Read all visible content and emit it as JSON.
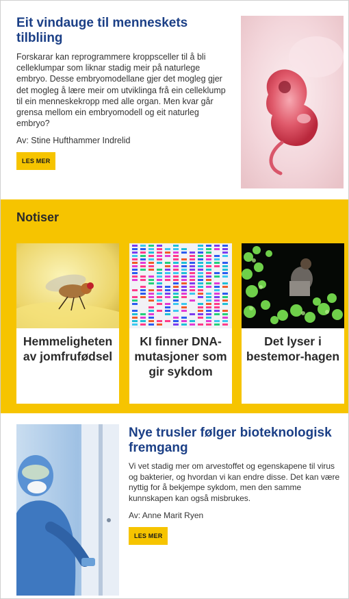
{
  "article1": {
    "title": "Eit vindauge til menneskets tilbliing",
    "summary": "Forskarar kan reprogrammere kroppsceller til å bli celleklumpar som liknar stadig meir på naturlege embryo. Desse embryomodellane gjer det mogleg gjer det mogleg å lære meir om utviklinga frå ein celleklump til ein menneskekropp med alle organ. Men kvar går grensa mellom ein embryomodell og eit naturleg embryo?",
    "byline": "Av: Stine Hufthammer Indrelid",
    "button": "LES MER",
    "image_icon": "embryo-photo"
  },
  "notiser": {
    "heading": "Notiser",
    "cards": [
      {
        "caption": "Hemmeligheten av jomfrufødsel",
        "image_icon": "fruit-fly-photo"
      },
      {
        "caption": "KI finner DNA-mutasjoner som gir sykdom",
        "image_icon": "dna-sequencing-bands"
      },
      {
        "caption": "Det lyser i bestemor-hagen",
        "image_icon": "glowing-plants-photo"
      }
    ]
  },
  "article2": {
    "title": "Nye trusler følger bioteknologisk fremgang",
    "summary": "Vi vet stadig mer om arvestoffet og egenskapene til virus og bakterier, og hvordan vi kan endre disse. Det kan være nyttig for å bekjempe sykdom, men den samme kunnskapen kan også misbrukes.",
    "byline": "Av: Anne Marit Ryen",
    "button": "LES MER",
    "image_icon": "lab-worker-photo"
  },
  "colors": {
    "title_blue": "#1b3f86",
    "accent_yellow": "#f6c400"
  }
}
